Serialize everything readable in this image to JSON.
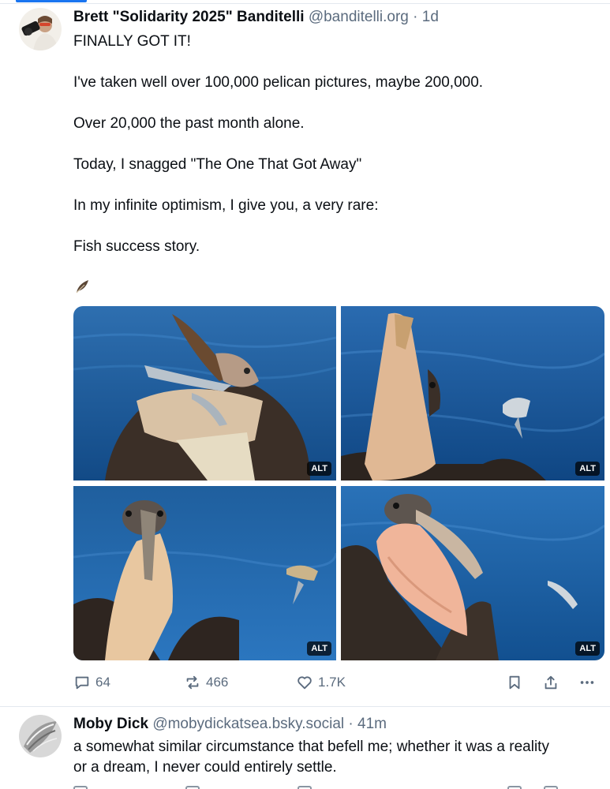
{
  "post": {
    "author_name": "Brett \"Solidarity 2025\" Banditelli",
    "handle": "@banditelli.org",
    "separator": "·",
    "age": "1d",
    "paragraphs": [
      "FINALLY GOT IT!",
      "I've taken well over 100,000 pelican pictures, maybe 200,000.",
      "Over 20,000 the past month alone.",
      "Today, I snagged \"The One That Got Away\"",
      "In my infinite optimism, I give you, a very rare:",
      "Fish success story."
    ],
    "emoji_icon": "feather-icon",
    "images": [
      {
        "alt_label": "ALT"
      },
      {
        "alt_label": "ALT"
      },
      {
        "alt_label": "ALT"
      },
      {
        "alt_label": "ALT"
      }
    ],
    "actions": {
      "replies": "64",
      "reposts": "466",
      "likes": "1.7K"
    }
  },
  "reply": {
    "author_name": "Moby Dick",
    "handle": "@mobydickatsea.bsky.social",
    "separator": "·",
    "age": "41m",
    "lines": [
      "a somewhat similar circumstance that befell me; whether it was a reality",
      "or a dream, I never could entirely settle."
    ]
  },
  "colors": {
    "accent": "#1a75f0",
    "muted_text": "#5b6b7e",
    "water": "#1f5f9e"
  }
}
